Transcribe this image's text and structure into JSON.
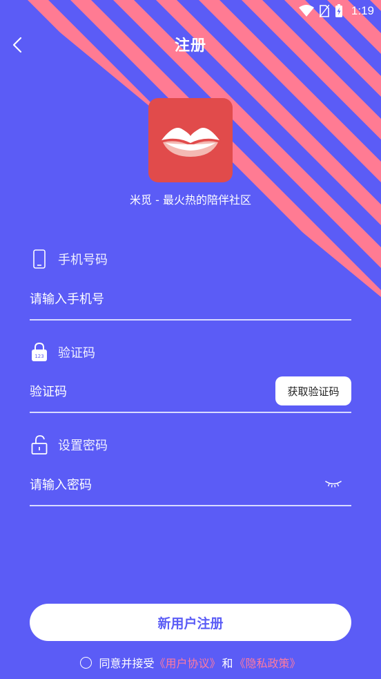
{
  "status_bar": {
    "time": "1:19"
  },
  "header": {
    "title": "注册"
  },
  "brand": {
    "slogan": "米觅 - 最火热的陪伴社区"
  },
  "form": {
    "phone": {
      "label": "手机号码",
      "placeholder": "请输入手机号"
    },
    "code": {
      "label": "验证码",
      "placeholder": "验证码",
      "button_label": "获取验证码"
    },
    "password": {
      "label": "设置密码",
      "placeholder": "请输入密码"
    }
  },
  "actions": {
    "register_label": "新用户注册"
  },
  "agreement": {
    "prefix": "同意并接受",
    "user_agreement": "《用户协议》",
    "conjunction": "和",
    "privacy_policy": "《隐私政策》"
  },
  "colors": {
    "background": "#5b5cf6",
    "stripe": "#ff7b93",
    "logo_bg": "#e14b4b",
    "link": "#ff7aa0"
  }
}
